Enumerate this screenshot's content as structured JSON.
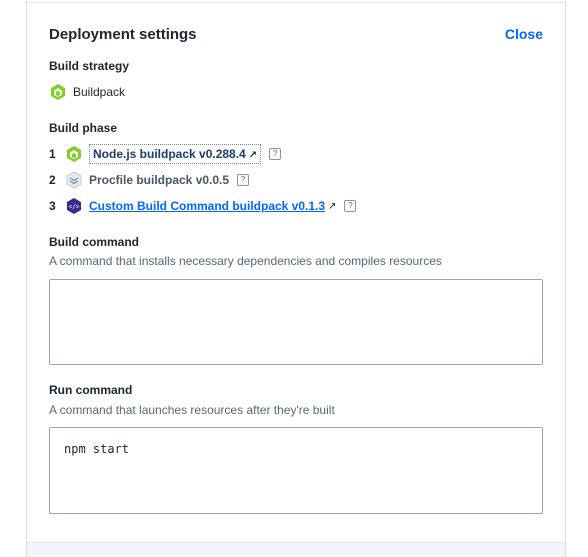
{
  "panel": {
    "title": "Deployment settings",
    "close_label": "Close"
  },
  "build_strategy": {
    "label": "Build strategy",
    "value": "Buildpack",
    "icon": "nodejs-hexagon-icon"
  },
  "build_phase": {
    "label": "Build phase",
    "items": [
      {
        "num": "1",
        "name": "Node.js buildpack v0.288.4",
        "icon": "nodejs-hexagon-icon",
        "link": true
      },
      {
        "num": "2",
        "name": "Procfile buildpack v0.0.5",
        "icon": "procfile-layers-icon",
        "link": false
      },
      {
        "num": "3",
        "name": "Custom Build Command buildpack v0.1.3",
        "icon": "code-hexagon-icon",
        "link": true
      }
    ],
    "help_glyph": "?",
    "external_glyph": "↗"
  },
  "build_command": {
    "label": "Build command",
    "help": "A command that installs necessary dependencies and compiles resources",
    "value": ""
  },
  "run_command": {
    "label": "Run command",
    "help": "A command that launches resources after they're built",
    "value": "npm start"
  },
  "colors": {
    "accent": "#0069ff",
    "nodejs_green": "#83cd29",
    "custom_purple": "#3b2a8f"
  }
}
